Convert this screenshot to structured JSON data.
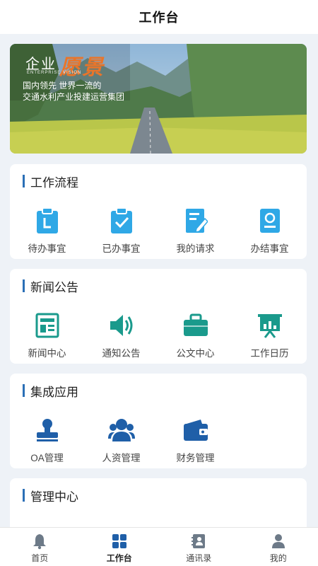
{
  "header": {
    "title": "工作台"
  },
  "banner": {
    "word1": "企业",
    "word2": "愿景",
    "small": "ENTERPRISE VISION",
    "line1": "国内领先 世界一流的",
    "line2": "交通水利产业投建运营集团"
  },
  "sections": [
    {
      "title": "工作流程",
      "items": [
        {
          "label": "待办事宜",
          "icon": "clipboard-clock-icon"
        },
        {
          "label": "已办事宜",
          "icon": "clipboard-check-icon"
        },
        {
          "label": "我的请求",
          "icon": "document-edit-icon"
        },
        {
          "label": "办结事宜",
          "icon": "certificate-icon"
        }
      ]
    },
    {
      "title": "新闻公告",
      "items": [
        {
          "label": "新闻中心",
          "icon": "newspaper-icon"
        },
        {
          "label": "通知公告",
          "icon": "speaker-icon"
        },
        {
          "label": "公文中心",
          "icon": "briefcase-icon"
        },
        {
          "label": "工作日历",
          "icon": "presentation-chart-icon"
        }
      ]
    },
    {
      "title": "集成应用",
      "items": [
        {
          "label": "OA管理",
          "icon": "stamp-icon"
        },
        {
          "label": "人资管理",
          "icon": "people-icon"
        },
        {
          "label": "财务管理",
          "icon": "wallet-icon"
        }
      ]
    },
    {
      "title": "管理中心",
      "items": []
    }
  ],
  "tabbar": [
    {
      "label": "首页",
      "icon": "bell-icon",
      "active": false
    },
    {
      "label": "工作台",
      "icon": "grid-icon",
      "active": true
    },
    {
      "label": "通讯录",
      "icon": "contacts-icon",
      "active": false
    },
    {
      "label": "我的",
      "icon": "user-icon",
      "active": false
    }
  ],
  "colors": {
    "accent": "#2b6fb6",
    "light_blue": "#2fa8e6",
    "teal": "#1a9a8c",
    "navy": "#1f5fa8",
    "background": "#eef2f7"
  }
}
